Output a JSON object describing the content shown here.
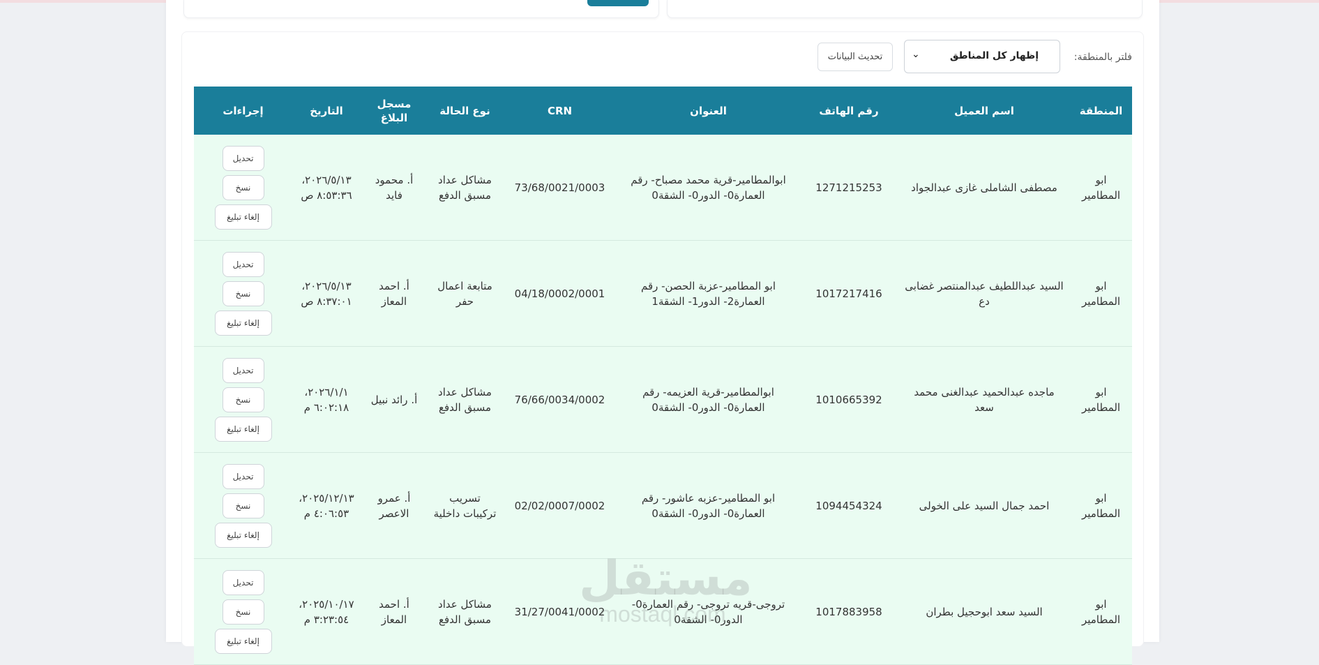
{
  "toolbar": {
    "filter_label": "فلتر بالمنطقة:",
    "select_value": "إظهار كل المناطق",
    "refresh_label": "تحديث البيانات"
  },
  "table": {
    "headers": [
      "المنطقة",
      "اسم العميل",
      "رقم الهاتف",
      "العنوان",
      "CRN",
      "نوع الحالة",
      "مسجل البلاغ",
      "التاريخ",
      "إجراءات"
    ],
    "actions": {
      "transfer": "تحديل",
      "copy": "نسخ",
      "cancel": "إلغاء تبليغ"
    },
    "rows": [
      {
        "region": "ابو المطامير",
        "client": "مصطفى الشاملى غازى عبدالجواد",
        "phone": "1271215253",
        "address": "ابوالمطامير-قرية محمد مصباح- رقم العمارة0- الدور0- الشقة0",
        "crn": "73/68/0021/0003",
        "case_type": "مشاكل عداد مسبق الدفع",
        "reporter": "أ. محمود فايد",
        "date": "٢٠٢٦/٥/١٣، ٨:٥٣:٣٦ ص"
      },
      {
        "region": "ابو المطامير",
        "client": "السيد عبداللطيف عبدالمنتصر غضابى دع",
        "phone": "1017217416",
        "address": "ابو المطامير-عزبة الحصن- رقم العمارة2- الدور1- الشقة1",
        "crn": "04/18/0002/0001",
        "case_type": "متابعة اعمال حفر",
        "reporter": "أ. احمد المعاز",
        "date": "٢٠٢٦/٥/١٣، ٨:٣٧:٠١ ص"
      },
      {
        "region": "ابو المطامير",
        "client": "ماجده عبدالحميد عبدالغنى محمد سعد",
        "phone": "1010665392",
        "address": "ابوالمطامير-قرية العزيمه- رقم العمارة0- الدور0- الشقة0",
        "crn": "76/66/0034/0002",
        "case_type": "مشاكل عداد مسبق الدفع",
        "reporter": "أ. رائد نبيل",
        "date": "٢٠٢٦/١/١، ٦:٠٢:١٨ م"
      },
      {
        "region": "ابو المطامير",
        "client": "احمد جمال السيد على الخولى",
        "phone": "1094454324",
        "address": "ابو المطامير-عزبه عاشور- رقم العمارة0- الدور0- الشقة0",
        "crn": "02/02/0007/0002",
        "case_type": "تسريب تركيبات داخلية",
        "reporter": "أ. عمرو الاعصر",
        "date": "٢٠٢٥/١٢/١٣، ٤:٠٦:٥٣ م"
      },
      {
        "region": "ابو المطامير",
        "client": "السيد سعد ابوحجيل بطران",
        "phone": "1017883958",
        "address": "تروجى-قريه تروجى- رقم العمارة0- الدور0- الشقة0",
        "crn": "31/27/0041/0002",
        "case_type": "مشاكل عداد مسبق الدفع",
        "reporter": "أ. احمد المعاز",
        "date": "٢٠٢٥/١٠/١٧، ٣:٢٣:٥٤ م"
      }
    ]
  },
  "watermark": {
    "arabic": "مستقل",
    "latin": "mostaql.com"
  }
}
